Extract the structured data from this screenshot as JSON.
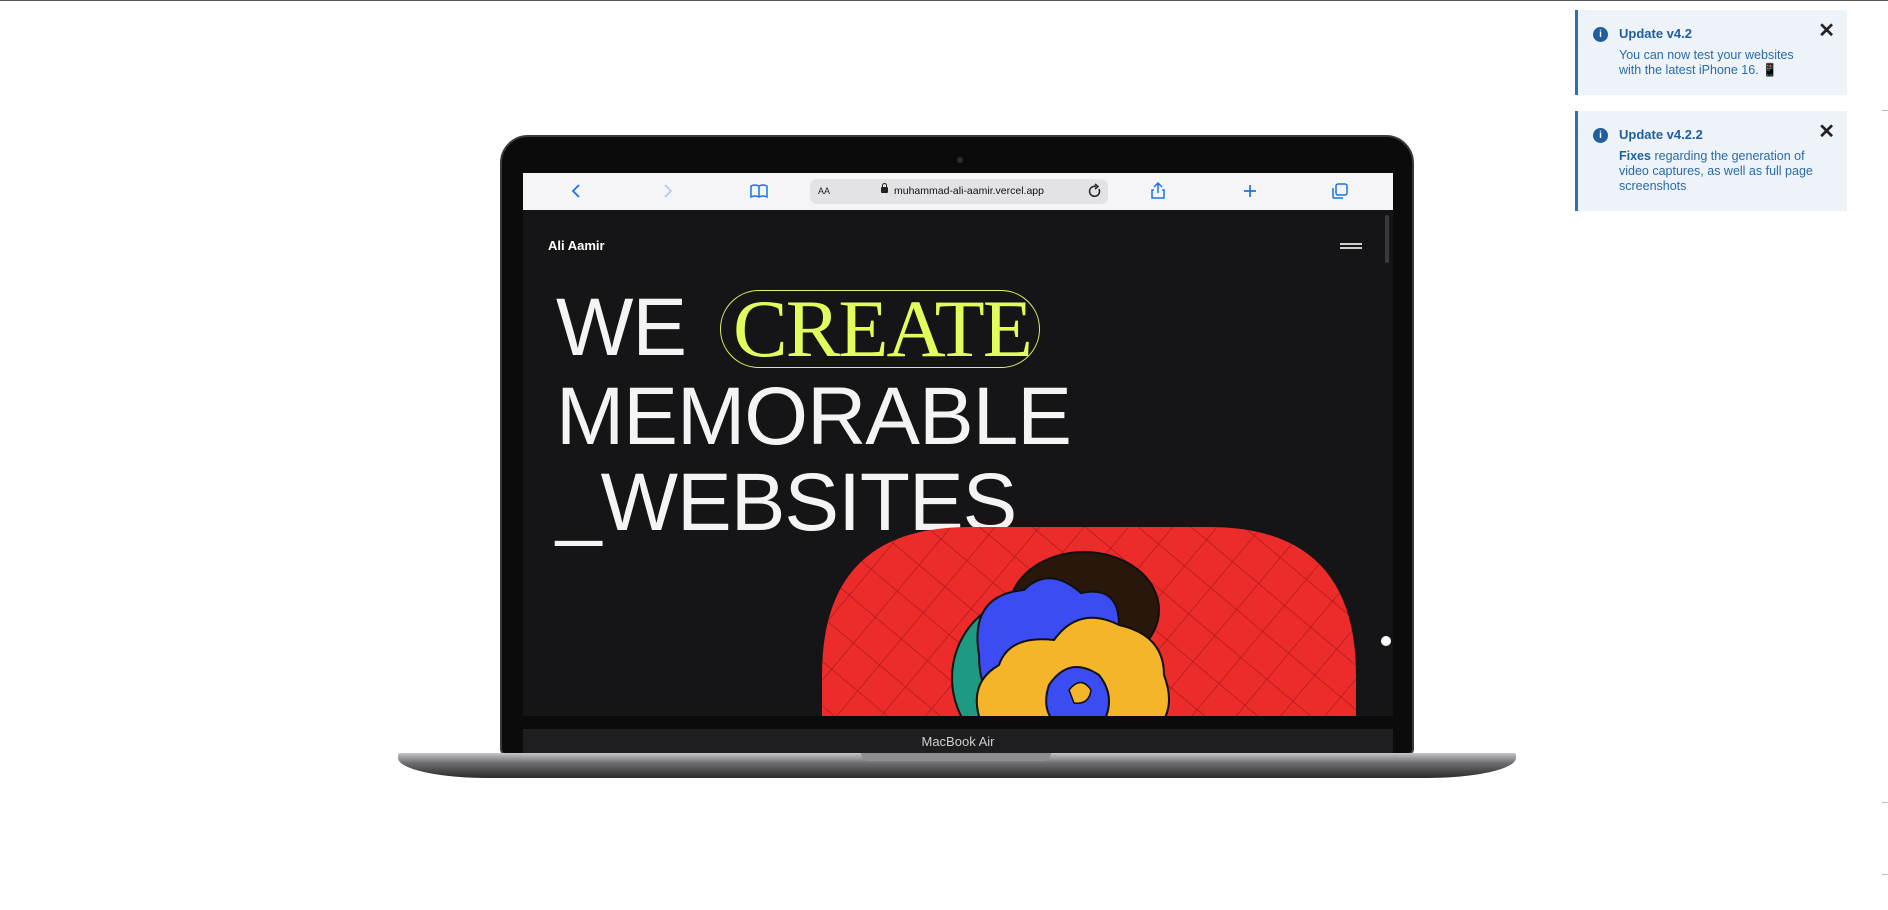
{
  "browser": {
    "url": "muhammad-ali-aamir.vercel.app",
    "reader_label": "AA",
    "icons": [
      "back-icon",
      "forward-icon",
      "bookmarks-icon",
      "reload-icon",
      "share-icon",
      "new-tab-icon",
      "tabs-icon"
    ]
  },
  "site": {
    "brand": "Ali Aamir",
    "hero": {
      "line1_word": "WE",
      "highlight": "CREATE",
      "line2": "MEMORABLE",
      "line3": "_WEBSITES"
    },
    "colors": {
      "background": "#151517",
      "highlight": "#e4fb5c",
      "art_red": "#ec2b2b",
      "art_blue": "#3a4cf2",
      "art_yellow": "#f5b52a",
      "art_green": "#1f9a82"
    }
  },
  "device": {
    "label": "MacBook Air"
  },
  "notifications": [
    {
      "title": "Update v4.2",
      "body": "You can now test your websites with the latest iPhone 16. 📱"
    },
    {
      "title": "Update v4.2.2",
      "body_bold": "Fixes",
      "body": "regarding the generation of video captures, as well as full page screenshots"
    }
  ]
}
